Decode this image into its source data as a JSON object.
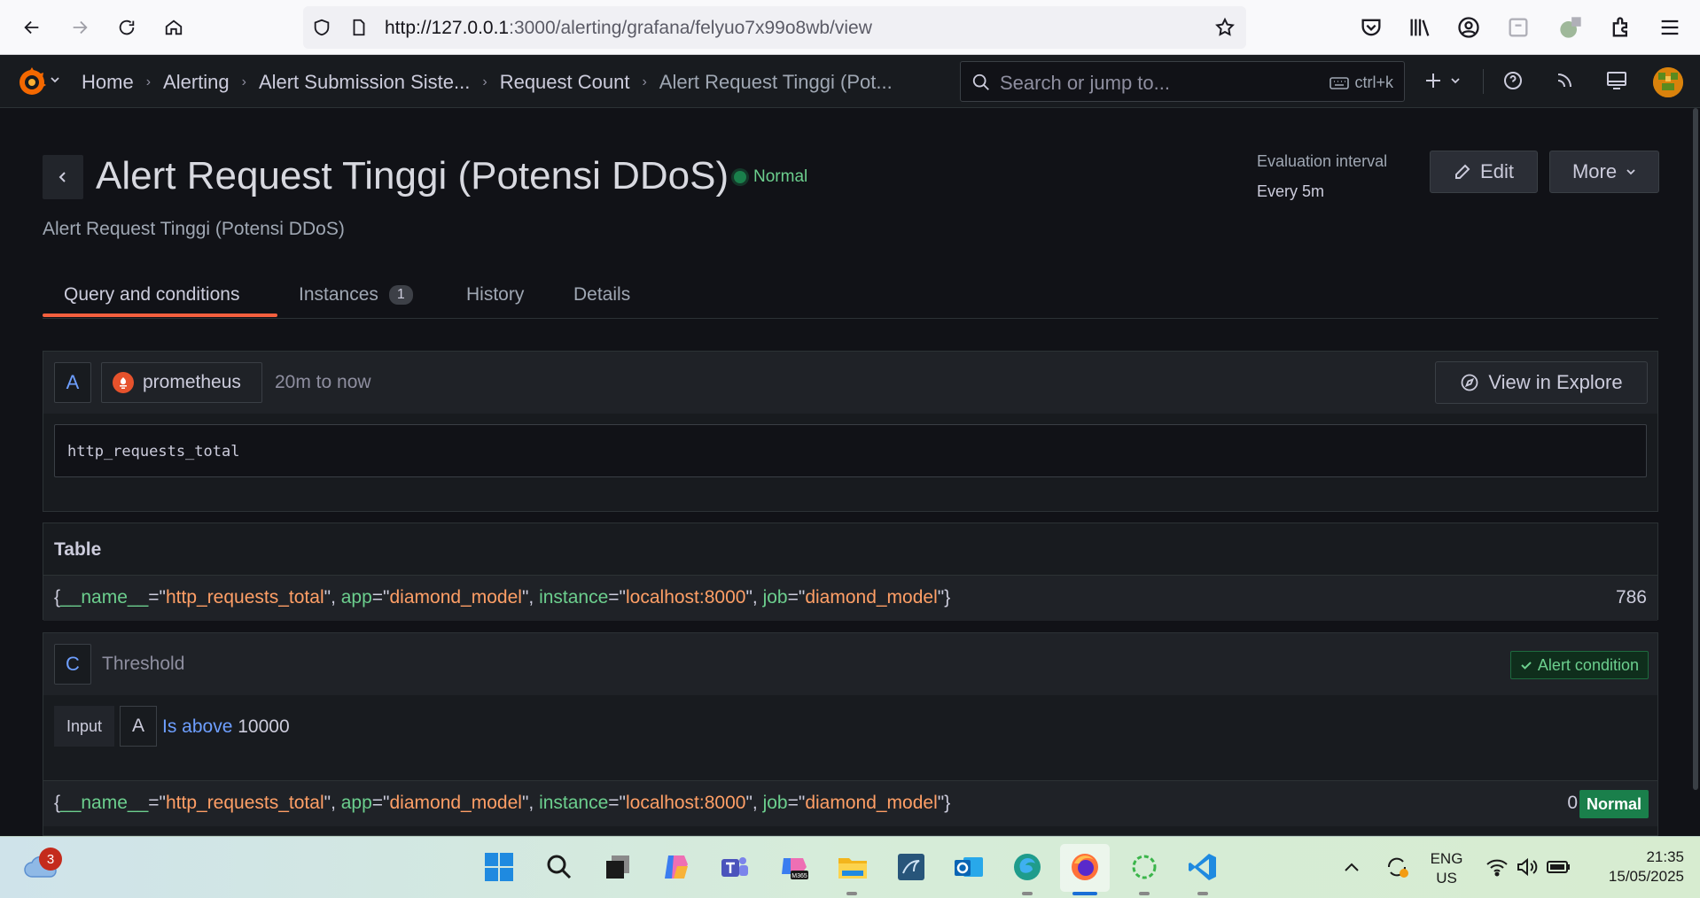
{
  "browser": {
    "url_host": "http://127.0.0.1",
    "url_rest": ":3000/alerting/grafana/felyuo7x99o8wb/view"
  },
  "topbar": {
    "breadcrumbs": [
      "Home",
      "Alerting",
      "Alert Submission Siste...",
      "Request Count",
      "Alert Request Tinggi (Pot..."
    ],
    "search_placeholder": "Search or jump to...",
    "search_shortcut": "ctrl+k"
  },
  "header": {
    "title": "Alert Request Tinggi (Potensi DDoS)",
    "state": "Normal",
    "subtitle": "Alert Request Tinggi (Potensi DDoS)",
    "eval_label": "Evaluation interval",
    "eval_value": "Every 5m",
    "edit_label": "Edit",
    "more_label": "More"
  },
  "tabs": [
    {
      "label": "Query and conditions"
    },
    {
      "label": "Instances",
      "count": "1"
    },
    {
      "label": "History"
    },
    {
      "label": "Details"
    }
  ],
  "query": {
    "ref_id": "A",
    "datasource": "prometheus",
    "time_range": "20m to now",
    "explore_label": "View in Explore",
    "expression": "http_requests_total"
  },
  "table": {
    "title": "Table",
    "row": {
      "labels": [
        {
          "key": "__name__",
          "value": "http_requests_total"
        },
        {
          "key": "app",
          "value": "diamond_model"
        },
        {
          "key": "instance",
          "value": "localhost:8000"
        },
        {
          "key": "job",
          "value": "diamond_model"
        }
      ],
      "value": "786"
    }
  },
  "condition": {
    "ref_id": "C",
    "name": "Threshold",
    "alert_condition_label": "Alert condition",
    "input_label": "Input",
    "input_ref": "A",
    "operator": "Is above",
    "threshold": "10000",
    "row": {
      "labels": [
        {
          "key": "__name__",
          "value": "http_requests_total"
        },
        {
          "key": "app",
          "value": "diamond_model"
        },
        {
          "key": "instance",
          "value": "localhost:8000"
        },
        {
          "key": "job",
          "value": "diamond_model"
        }
      ],
      "value": "0",
      "state": "Normal"
    }
  },
  "taskbar": {
    "weather_badge": "3",
    "lang_line1": "ENG",
    "lang_line2": "US",
    "time": "21:35",
    "date": "15/05/2025"
  },
  "colors": {
    "accent": "#f55f3e",
    "normal_green": "#1a7f4b",
    "label_key": "#6ccf8e",
    "label_value": "#ff9f66",
    "operator_blue": "#6e9fff"
  }
}
